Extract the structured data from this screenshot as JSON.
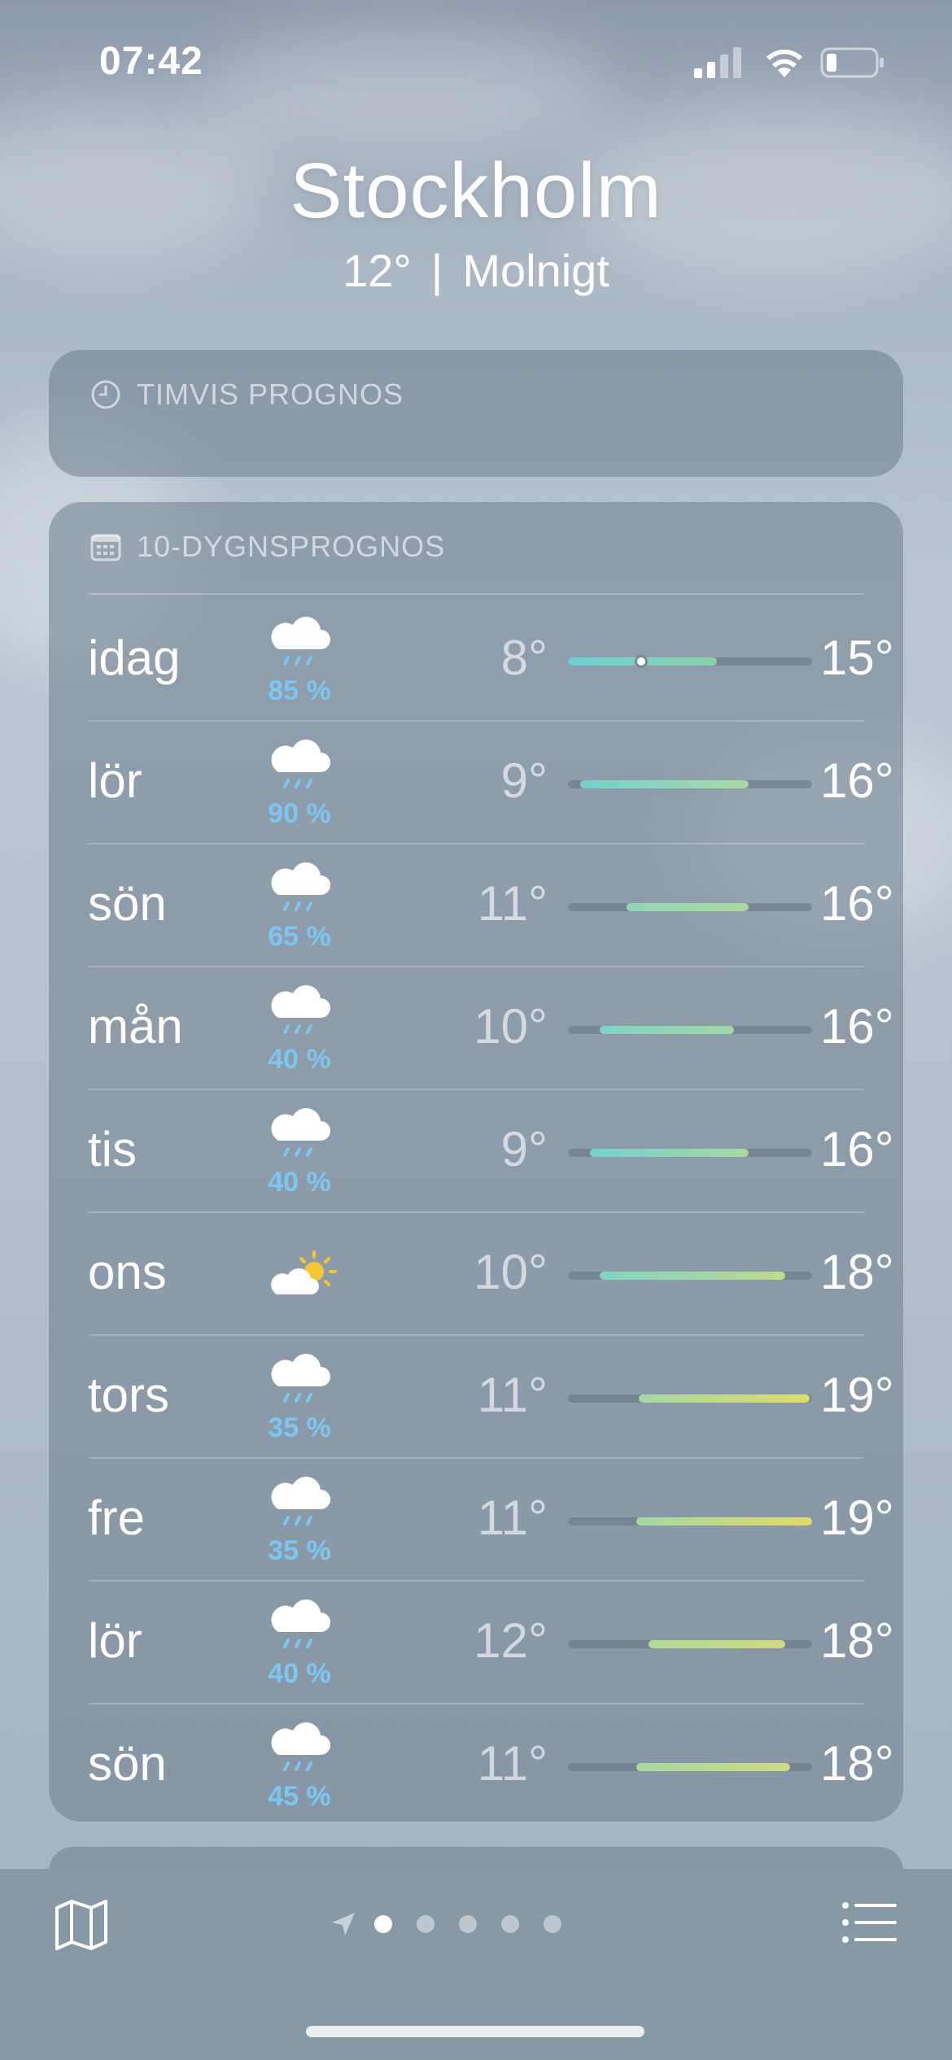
{
  "status_bar": {
    "time": "07:42"
  },
  "header": {
    "city": "Stockholm",
    "temperature": "12°",
    "separator": "|",
    "condition": "Molnigt"
  },
  "hourly": {
    "title": "TIMVIS PROGNOS"
  },
  "daily": {
    "title": "10-DYGNSPROGNOS",
    "days": [
      {
        "day": "idag",
        "icon": "cloud-rain-icon",
        "precip": "85 %",
        "low": "8°",
        "high": "15°",
        "bar_start": 0.0,
        "bar_end": 0.61,
        "current": 0.3,
        "color_a": "#6fd0d6",
        "color_b": "#8bd3a7"
      },
      {
        "day": "lör",
        "icon": "cloud-rain-icon",
        "precip": "90 %",
        "low": "9°",
        "high": "16°",
        "bar_start": 0.05,
        "bar_end": 0.74,
        "color_a": "#74d1d0",
        "color_b": "#a8d8a0"
      },
      {
        "day": "sön",
        "icon": "cloud-rain-icon",
        "precip": "65 %",
        "low": "11°",
        "high": "16°",
        "bar_start": 0.24,
        "bar_end": 0.74,
        "color_a": "#92d5b5",
        "color_b": "#a8d8a0"
      },
      {
        "day": "mån",
        "icon": "cloud-rain-icon",
        "precip": "40 %",
        "low": "10°",
        "high": "16°",
        "bar_start": 0.13,
        "bar_end": 0.68,
        "color_a": "#80d3c5",
        "color_b": "#a0d7a6"
      },
      {
        "day": "tis",
        "icon": "cloud-rain-icon",
        "precip": "40 %",
        "low": "9°",
        "high": "16°",
        "bar_start": 0.09,
        "bar_end": 0.74,
        "color_a": "#74d1d0",
        "color_b": "#a8d8a0"
      },
      {
        "day": "ons",
        "icon": "cloud-sun-icon",
        "precip": "",
        "low": "10°",
        "high": "18°",
        "bar_start": 0.13,
        "bar_end": 0.89,
        "color_a": "#80d3c5",
        "color_b": "#c0da8a"
      },
      {
        "day": "tors",
        "icon": "cloud-rain-icon",
        "precip": "35 %",
        "low": "11°",
        "high": "19°",
        "bar_start": 0.29,
        "bar_end": 0.99,
        "color_a": "#a4d8a4",
        "color_b": "#dfdc6a"
      },
      {
        "day": "fre",
        "icon": "cloud-rain-icon",
        "precip": "35 %",
        "low": "11°",
        "high": "19°",
        "bar_start": 0.28,
        "bar_end": 1.0,
        "color_a": "#a4d8a4",
        "color_b": "#e3dc66"
      },
      {
        "day": "lör",
        "icon": "cloud-rain-icon",
        "precip": "40 %",
        "low": "12°",
        "high": "18°",
        "bar_start": 0.33,
        "bar_end": 0.89,
        "color_a": "#b2d99a",
        "color_b": "#cfdb80"
      },
      {
        "day": "sön",
        "icon": "cloud-rain-icon",
        "precip": "45 %",
        "low": "11°",
        "high": "18°",
        "bar_start": 0.28,
        "bar_end": 0.91,
        "color_a": "#a4d8a4",
        "color_b": "#cfdb80"
      }
    ]
  },
  "bottom_bar": {
    "map_icon": "map-icon",
    "location_icon": "location-arrow-icon",
    "page_count": 5,
    "active_page": 0,
    "list_icon": "list-icon"
  }
}
